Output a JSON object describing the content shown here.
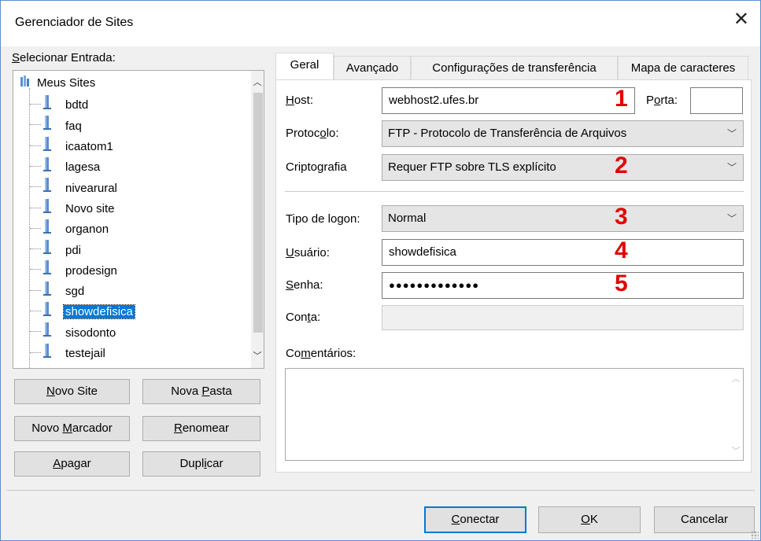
{
  "window": {
    "title": "Gerenciador de Sites",
    "close_label": "✕"
  },
  "left": {
    "label_prefix": "S",
    "label_rest": "elecionar Entrada:",
    "root": "Meus Sites",
    "sites": [
      "bdtd",
      "faq",
      "icaatom1",
      "lagesa",
      "nivearural",
      "Novo site",
      "organon",
      "pdi",
      "prodesign",
      "sgd",
      "showdefisica",
      "sisodonto",
      "testejail"
    ],
    "selected": "showdefisica"
  },
  "buttons": {
    "novo_site": {
      "u": "N",
      "rest": "ovo Site"
    },
    "nova_pasta": {
      "pre": "Nova ",
      "u": "P",
      "rest": "asta"
    },
    "novo_marcador": {
      "pre": "Novo ",
      "u": "M",
      "rest": "arcador"
    },
    "renomear": {
      "u": "R",
      "rest": "enomear"
    },
    "apagar": {
      "u": "A",
      "rest": "pagar"
    },
    "duplicar": {
      "pre": "Dupl",
      "u": "i",
      "rest": "car"
    },
    "conectar": {
      "u": "C",
      "rest": "onectar"
    },
    "ok": {
      "u": "O",
      "rest": "K"
    },
    "cancelar": "Cancelar"
  },
  "tabs": [
    "Geral",
    "Avançado",
    "Configurações de transferência",
    "Mapa de caracteres"
  ],
  "form": {
    "host_label_u": "H",
    "host_label_rest": "ost:",
    "host": "webhost2.ufes.br",
    "porta_label_pre": "P",
    "porta_label_u": "o",
    "porta_label_rest": "rta:",
    "porta": "",
    "protocolo_label_pre": "Protoc",
    "protocolo_label_u": "o",
    "protocolo_label_rest": "lo:",
    "protocolo": "FTP - Protocolo de Transferência de Arquivos",
    "cripto_label_pre": "Cripto",
    "cripto_label_u": "g",
    "cripto_label_rest": "rafia",
    "cripto": "Requer FTP sobre TLS explícito",
    "logon_label": "Tipo de logon:",
    "logon": "Normal",
    "usuario_label_u": "U",
    "usuario_label_rest": "suário:",
    "usuario": "showdefisica",
    "senha_label_u": "S",
    "senha_label_rest": "enha:",
    "senha": "●●●●●●●●●●●●●",
    "conta_label_pre": "Con",
    "conta_label_u": "t",
    "conta_label_rest": "a:",
    "conta": "",
    "comentarios_label_pre": "Co",
    "comentarios_label_u": "m",
    "comentarios_label_rest": "entários:"
  },
  "annotations": [
    "1",
    "2",
    "3",
    "4",
    "5"
  ],
  "colors": {
    "selection": "#0078d7",
    "annotation": "#e00000",
    "window_border": "#5b8fc9"
  }
}
